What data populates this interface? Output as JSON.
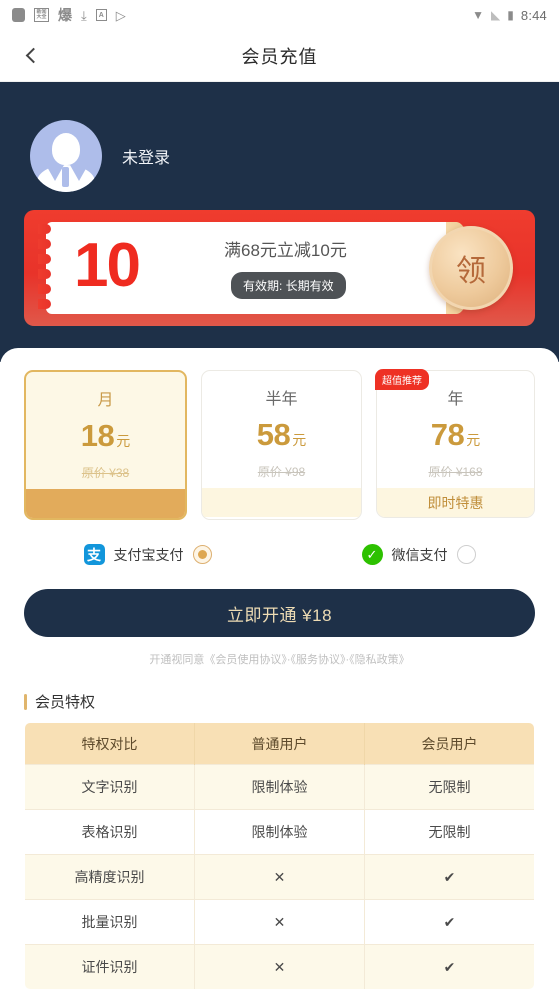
{
  "status_bar": {
    "left_icons": [
      "rounded-square-icon",
      "boxed-char-icon",
      "app-char-icon",
      "download-icon",
      "boxed-a-icon",
      "play-store-icon"
    ],
    "left_glyphs": [
      "",
      "新闻\n大全",
      "爆",
      "⤓",
      "A",
      "▷"
    ],
    "wifi": "▼",
    "signal": "◣",
    "battery": "▮",
    "time": "8:44"
  },
  "header": {
    "back_label": "",
    "title": "会员充值"
  },
  "profile": {
    "name": "未登录"
  },
  "coupon": {
    "amount": "10",
    "description": "满68元立减10元",
    "validity": "有效期: 长期有效",
    "claim_label": "领"
  },
  "plans": [
    {
      "name": "月",
      "price": "18",
      "unit": "元",
      "original": "原价 ¥38",
      "footer": "",
      "badge": "",
      "selected": true
    },
    {
      "name": "半年",
      "price": "58",
      "unit": "元",
      "original": "原价 ¥98",
      "footer": "",
      "badge": "",
      "selected": false
    },
    {
      "name": "年",
      "price": "78",
      "unit": "元",
      "original": "原价 ¥168",
      "footer": "即时特惠",
      "badge": "超值推荐",
      "selected": false
    }
  ],
  "payments": [
    {
      "label": "支付宝支付",
      "icon_glyph": "支",
      "icon": "alipay-icon",
      "selected": true
    },
    {
      "label": "微信支付",
      "icon_glyph": "✓",
      "icon": "wechat-pay-icon",
      "selected": false
    }
  ],
  "cta": {
    "label": "立即开通 ¥18",
    "agreement": "开通视同意《会员使用协议》·《服务协议》·《隐私政策》"
  },
  "privileges": {
    "section_title": "会员特权",
    "headers": [
      "特权对比",
      "普通用户",
      "会员用户"
    ],
    "rows": [
      {
        "feature": "文字识别",
        "free": "限制体验",
        "vip": "无限制"
      },
      {
        "feature": "表格识别",
        "free": "限制体验",
        "vip": "无限制"
      },
      {
        "feature": "高精度识别",
        "free": "✕",
        "vip": "✔"
      },
      {
        "feature": "批量识别",
        "free": "✕",
        "vip": "✔"
      },
      {
        "feature": "证件识别",
        "free": "✕",
        "vip": "✔"
      }
    ]
  },
  "colors": {
    "navy": "#1e3048",
    "gold": "#cb9a3c",
    "coupon_red": "#ee3124",
    "alipay_blue": "#1296db",
    "wechat_green": "#2dc100",
    "cross_orange": "#f05a28",
    "check_green": "#2ebb3c"
  }
}
